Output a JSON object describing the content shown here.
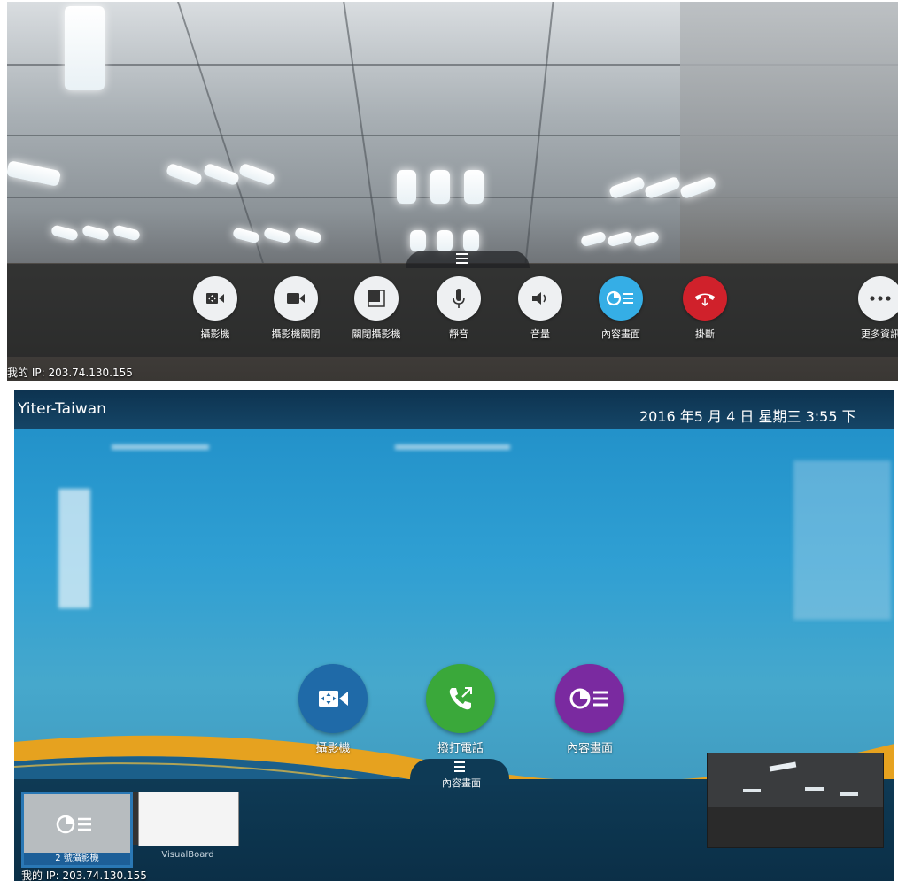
{
  "top_panel": {
    "toolbar": [
      {
        "label": "攝影機",
        "icon": "camera-move-icon"
      },
      {
        "label": "攝影機關閉",
        "icon": "video-camera-icon"
      },
      {
        "label": "關閉攝影機",
        "icon": "self-view-off-icon"
      },
      {
        "label": "靜音",
        "icon": "microphone-icon"
      },
      {
        "label": "音量",
        "icon": "speaker-icon"
      },
      {
        "label": "內容畫面",
        "icon": "content-share-icon"
      },
      {
        "label": "掛斷",
        "icon": "hang-up-icon"
      },
      {
        "label": "更多資訊",
        "icon": "more-icon"
      }
    ],
    "ip_text": "我的 IP: 203.74.130.155",
    "colors": {
      "content_active": "#35aee6",
      "hangup": "#d0212b",
      "button_bg": "#eef0f2"
    }
  },
  "bottom_panel": {
    "header": {
      "brand": "Yiter-Taiwan",
      "datetime": "2016 年5 月 4 日 星期三     3:55 下"
    },
    "home_buttons": [
      {
        "label": "攝影機",
        "icon": "camera-move-icon",
        "color": "#1f6aa8"
      },
      {
        "label": "撥打電話",
        "icon": "phone-dial-icon",
        "color": "#3aa83a"
      },
      {
        "label": "內容畫面",
        "icon": "content-share-icon",
        "color": "#7a2aa0"
      }
    ],
    "tray": {
      "title": "內容畫面",
      "items": [
        {
          "label": "2 號攝影機",
          "icon": "content-share-icon"
        },
        {
          "label": "VisualBoard"
        }
      ]
    },
    "ip_text": "我的 IP: 203.74.130.155"
  }
}
